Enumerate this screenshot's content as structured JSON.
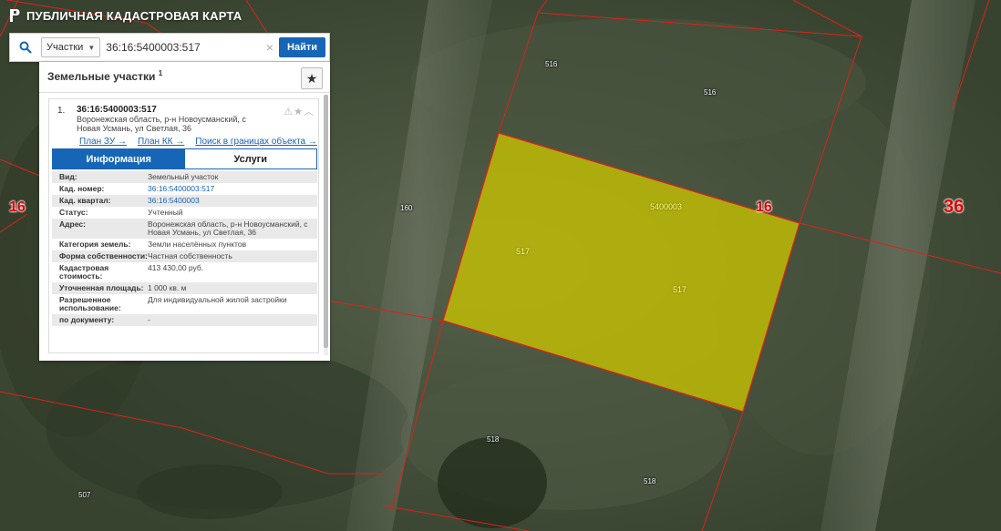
{
  "app": {
    "title": "ПУБЛИЧНАЯ КАДАСТРОВАЯ КАРТА"
  },
  "search": {
    "type_label": "Участки",
    "query": "36:16:5400003:517",
    "button_label": "Найти"
  },
  "panel": {
    "title": "Земельные участки",
    "count": "1"
  },
  "result": {
    "index": "1.",
    "cad_number": "36:16:5400003:517",
    "address": "Воронежская область, р-н Новоусманский, с Новая Усмань, ул Светлая, 36",
    "links": [
      "План ЗУ →",
      "План КК →",
      "Поиск в границах объекта →"
    ],
    "tabs": [
      {
        "label": "Информация",
        "active": true
      },
      {
        "label": "Услуги",
        "active": false
      }
    ],
    "rows": [
      {
        "label": "Вид:",
        "value": "Земельный участок"
      },
      {
        "label": "Кад. номер:",
        "value": "36:16:5400003:517"
      },
      {
        "label": "Кад. квартал:",
        "value": "36:16:5400003"
      },
      {
        "label": "Статус:",
        "value": "Учтенный"
      },
      {
        "label": "Адрес:",
        "value": "Воронежская область, р-н Новоусманский, с Новая Усмань, ул Светлая, 36"
      },
      {
        "label": "Категория земель:",
        "value": "Земли населённых пунктов"
      },
      {
        "label": "Форма собственности:",
        "value": "Частная собственность"
      },
      {
        "label": "Кадастровая стоимость:",
        "value": "413 430,00 руб."
      },
      {
        "label": "Уточненная площадь:",
        "value": "1 000 кв. м"
      },
      {
        "label": "Разрешенное использование:",
        "value": "Для индивидуальной жилой застройки"
      },
      {
        "label": "по документу:",
        "value": "-"
      }
    ]
  },
  "map_labels": {
    "l516a": "516",
    "l516b": "516",
    "l16_left": "16",
    "l160": "160",
    "l5400003": "5400003",
    "l16_right": "16",
    "l36": "36",
    "l517a": "517",
    "l517b": "517",
    "l518a": "518",
    "l518b": "518",
    "l507": "507"
  },
  "colors": {
    "boundary": "#e0201a",
    "parcel_fill": "#c9c400",
    "accent": "#1665b6"
  }
}
